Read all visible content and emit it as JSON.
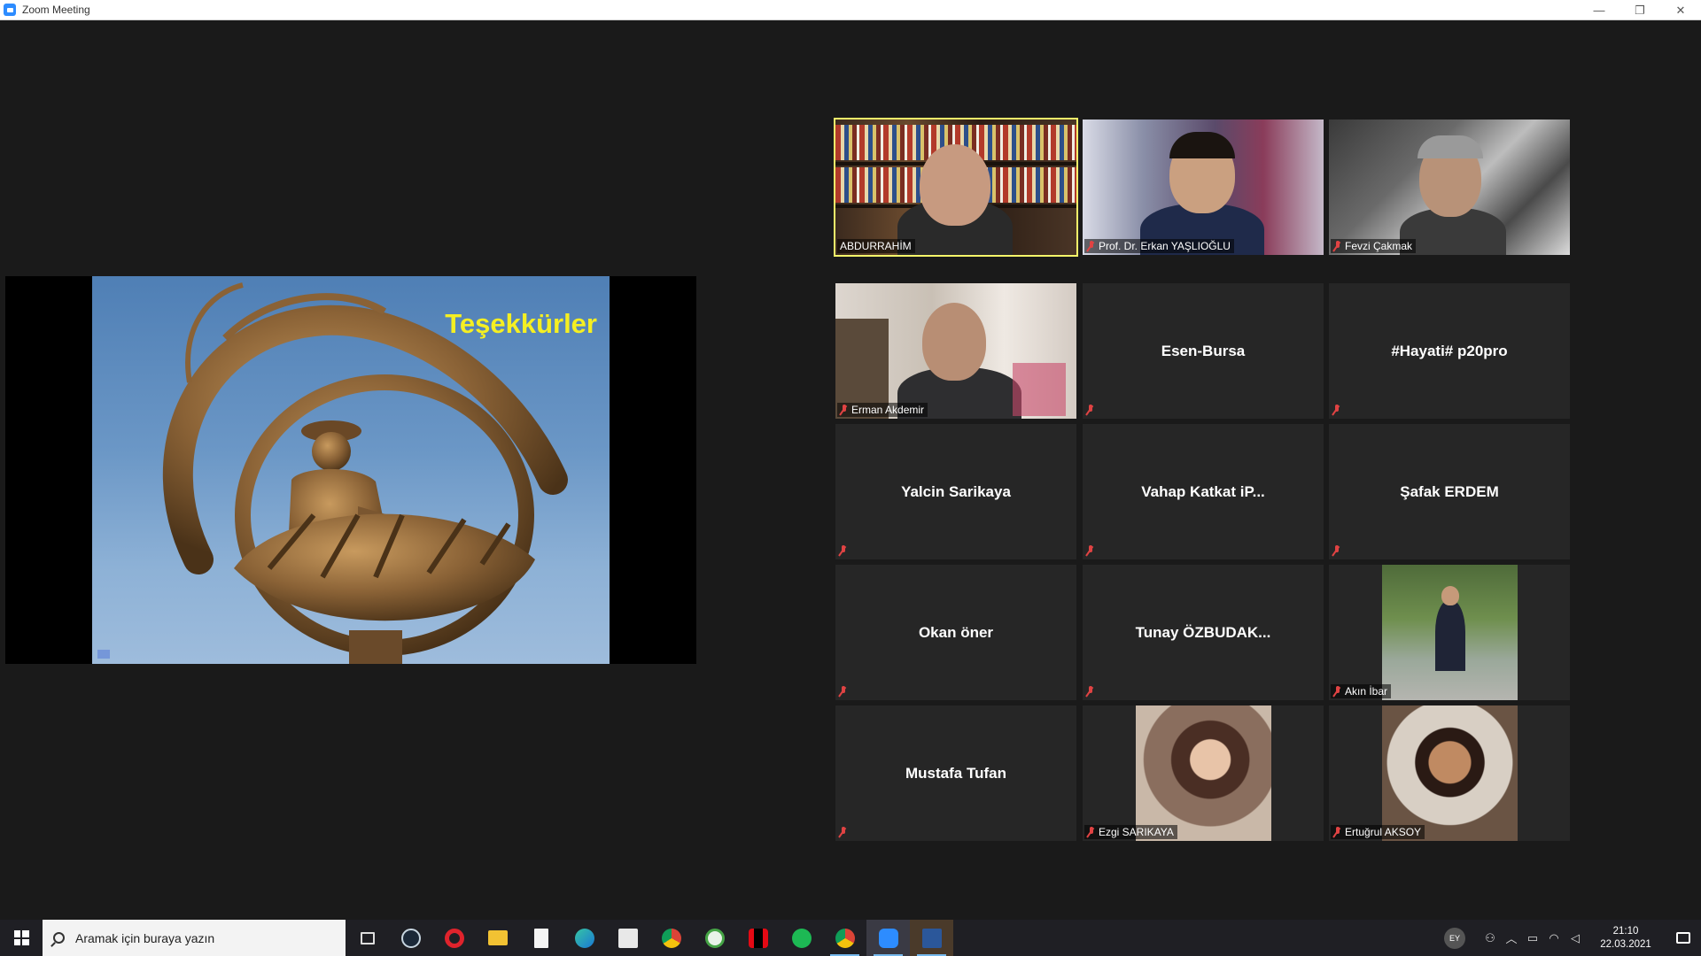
{
  "window": {
    "title": "Zoom Meeting",
    "controls": [
      "—",
      "❐",
      "✕"
    ]
  },
  "share": {
    "slide_title": "Teşekkürler"
  },
  "participants": [
    {
      "name": "ABDURRAHİM",
      "video": true,
      "muted": false,
      "active": true
    },
    {
      "name": "Prof. Dr. Erkan YAŞLIOĞLU",
      "video": true,
      "muted": true
    },
    {
      "name": "Fevzi Çakmak",
      "video": true,
      "muted": true
    },
    {
      "name": "Erman Akdemir",
      "video": true,
      "muted": true
    },
    {
      "name": "Esen-Bursa",
      "video": false,
      "muted": true
    },
    {
      "name": "#Hayati# p20pro",
      "video": false,
      "muted": true
    },
    {
      "name": "Yalcin Sarikaya",
      "video": false,
      "muted": true
    },
    {
      "name": "Vahap Katkat iP...",
      "video": false,
      "muted": true
    },
    {
      "name": "Şafak ERDEM",
      "video": false,
      "muted": true
    },
    {
      "name": "Okan öner",
      "video": false,
      "muted": true
    },
    {
      "name": "Tunay  ÖZBUDAK...",
      "video": false,
      "muted": true
    },
    {
      "name": "Akın İbar",
      "video": true,
      "muted": true
    },
    {
      "name": "Mustafa Tufan",
      "video": false,
      "muted": true
    },
    {
      "name": "Ezgi SARIKAYA",
      "video": true,
      "muted": true
    },
    {
      "name": "Ertuğrul AKSOY",
      "video": true,
      "muted": true
    }
  ],
  "taskbar": {
    "search_placeholder": "Aramak için buraya yazın",
    "icons": [
      "task-view-icon",
      "steam-icon",
      "opera-icon",
      "file-explorer-icon",
      "notepad-icon",
      "edge-icon",
      "store-icon",
      "chrome-icon",
      "vpn-icon",
      "netflix-icon",
      "spotify-icon",
      "chrome-profile-icon",
      "zoom-icon",
      "word-icon"
    ],
    "user_initials": "EY",
    "time": "21:10",
    "date": "22.03.2021"
  }
}
